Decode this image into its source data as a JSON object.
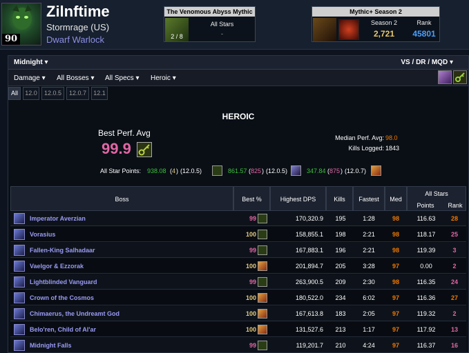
{
  "character": {
    "level": "90",
    "name": "Zilnftime",
    "realm": "Stormrage (US)",
    "class": "Dwarf Warlock"
  },
  "raid_box": {
    "title": "The Venomous Abyss Mythic",
    "progress": "2 / 8",
    "label": "All Stars",
    "value": "-"
  },
  "mplus_box": {
    "title": "Mythic+ Season 2",
    "season_label": "Season 2",
    "score": "2,721",
    "rank_label": "Rank",
    "rank": "45801"
  },
  "toolbar": {
    "raid_dropdown": "Midnight",
    "mode_dropdown": "VS / DR / MQD",
    "filters": [
      "Damage",
      "All Bosses",
      "All Specs",
      "Heroic"
    ]
  },
  "tabs": [
    "All",
    "12.0",
    "12.0.5",
    "12.0.7",
    "12.1"
  ],
  "summary": {
    "title": "HEROIC",
    "best_perf_label": "Best Perf. Avg",
    "best_perf_value": "99.9",
    "median_label": "Median Perf. Avg:",
    "median_value": "98.0",
    "kills_label": "Kills Logged:",
    "kills_value": "1843",
    "all_star_label": "All Star Points:",
    "all_star": [
      {
        "points": "938.08",
        "rank": "4",
        "patch": "(12.0.5)"
      },
      {
        "points": "861.57",
        "rank": "825",
        "patch": "(12.0.5)"
      },
      {
        "points": "347.84",
        "rank": "875",
        "patch": "(12.0.7)"
      }
    ]
  },
  "table": {
    "headers": {
      "boss": "Boss",
      "best": "Best %",
      "dps": "Highest DPS",
      "kills": "Kills",
      "fastest": "Fastest",
      "med": "Med",
      "all_stars": "All Stars",
      "points": "Points",
      "rank": "Rank"
    },
    "rows": [
      {
        "boss": "Imperator Averzian",
        "best": "99",
        "dps": "170,320.9",
        "kills": "195",
        "fastest": "1:28",
        "med": "98",
        "points": "116.63",
        "rank": "28"
      },
      {
        "boss": "Vorasius",
        "best": "100",
        "dps": "158,855.1",
        "kills": "198",
        "fastest": "2:21",
        "med": "98",
        "points": "118.17",
        "rank": "25"
      },
      {
        "boss": "Fallen-King Salhadaar",
        "best": "99",
        "dps": "167,883.1",
        "kills": "196",
        "fastest": "2:21",
        "med": "98",
        "points": "119.39",
        "rank": "3"
      },
      {
        "boss": "Vaelgor & Ezzorak",
        "best": "100",
        "dps": "201,894.7",
        "kills": "205",
        "fastest": "3:28",
        "med": "97",
        "points": "0.00",
        "rank": "2"
      },
      {
        "boss": "Lightblinded Vanguard",
        "best": "99",
        "dps": "263,900.5",
        "kills": "209",
        "fastest": "2:30",
        "med": "98",
        "points": "116.35",
        "rank": "24"
      },
      {
        "boss": "Crown of the Cosmos",
        "best": "100",
        "dps": "180,522.0",
        "kills": "234",
        "fastest": "6:02",
        "med": "97",
        "points": "116.36",
        "rank": "27"
      },
      {
        "boss": "Chimaerus, the Undreamt God",
        "best": "100",
        "dps": "167,613.8",
        "kills": "183",
        "fastest": "2:05",
        "med": "97",
        "points": "119.32",
        "rank": "2"
      },
      {
        "boss": "Belo'ren, Child of Al'ar",
        "best": "100",
        "dps": "131,527.6",
        "kills": "213",
        "fastest": "1:17",
        "med": "97",
        "points": "117.92",
        "rank": "13"
      },
      {
        "boss": "Midnight Falls",
        "best": "99",
        "dps": "119,201.7",
        "kills": "210",
        "fastest": "4:24",
        "med": "97",
        "points": "116.37",
        "rank": "16"
      }
    ]
  },
  "colors": {
    "pink": "#e266a4",
    "gold": "#e5cc80",
    "orange": "#f07800",
    "boss_name": "#9a9af4",
    "green": "#3cc23c",
    "rank_blue": "#4aa0ff"
  }
}
